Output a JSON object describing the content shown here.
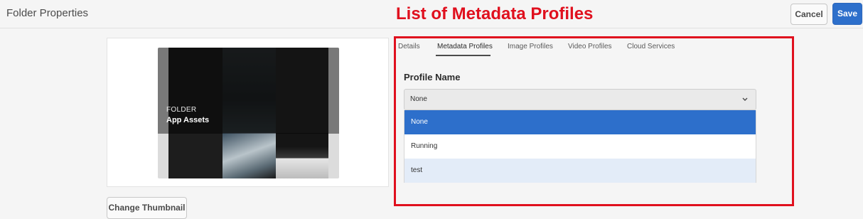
{
  "header": {
    "title": "Folder Properties",
    "cancel_label": "Cancel",
    "save_label": "Save"
  },
  "annotation": {
    "text": "List of Metadata Profiles",
    "color": "#e0101e"
  },
  "thumbnail": {
    "type_label": "FOLDER",
    "name": "App Assets",
    "change_button_label": "Change Thumbnail"
  },
  "tabs": [
    {
      "label": "Details",
      "active": false
    },
    {
      "label": "Metadata Profiles",
      "active": true
    },
    {
      "label": "Image Profiles",
      "active": false
    },
    {
      "label": "Video Profiles",
      "active": false
    },
    {
      "label": "Cloud Services",
      "active": false
    }
  ],
  "profile": {
    "label": "Profile Name",
    "selected_value": "None",
    "chevron_icon": "chevron-down-icon",
    "options": [
      {
        "label": "None",
        "state": "selected"
      },
      {
        "label": "Running",
        "state": "normal"
      },
      {
        "label": "test",
        "state": "hover"
      }
    ]
  },
  "colors": {
    "accent": "#2d6fcb",
    "hover": "#e3ecf8"
  }
}
